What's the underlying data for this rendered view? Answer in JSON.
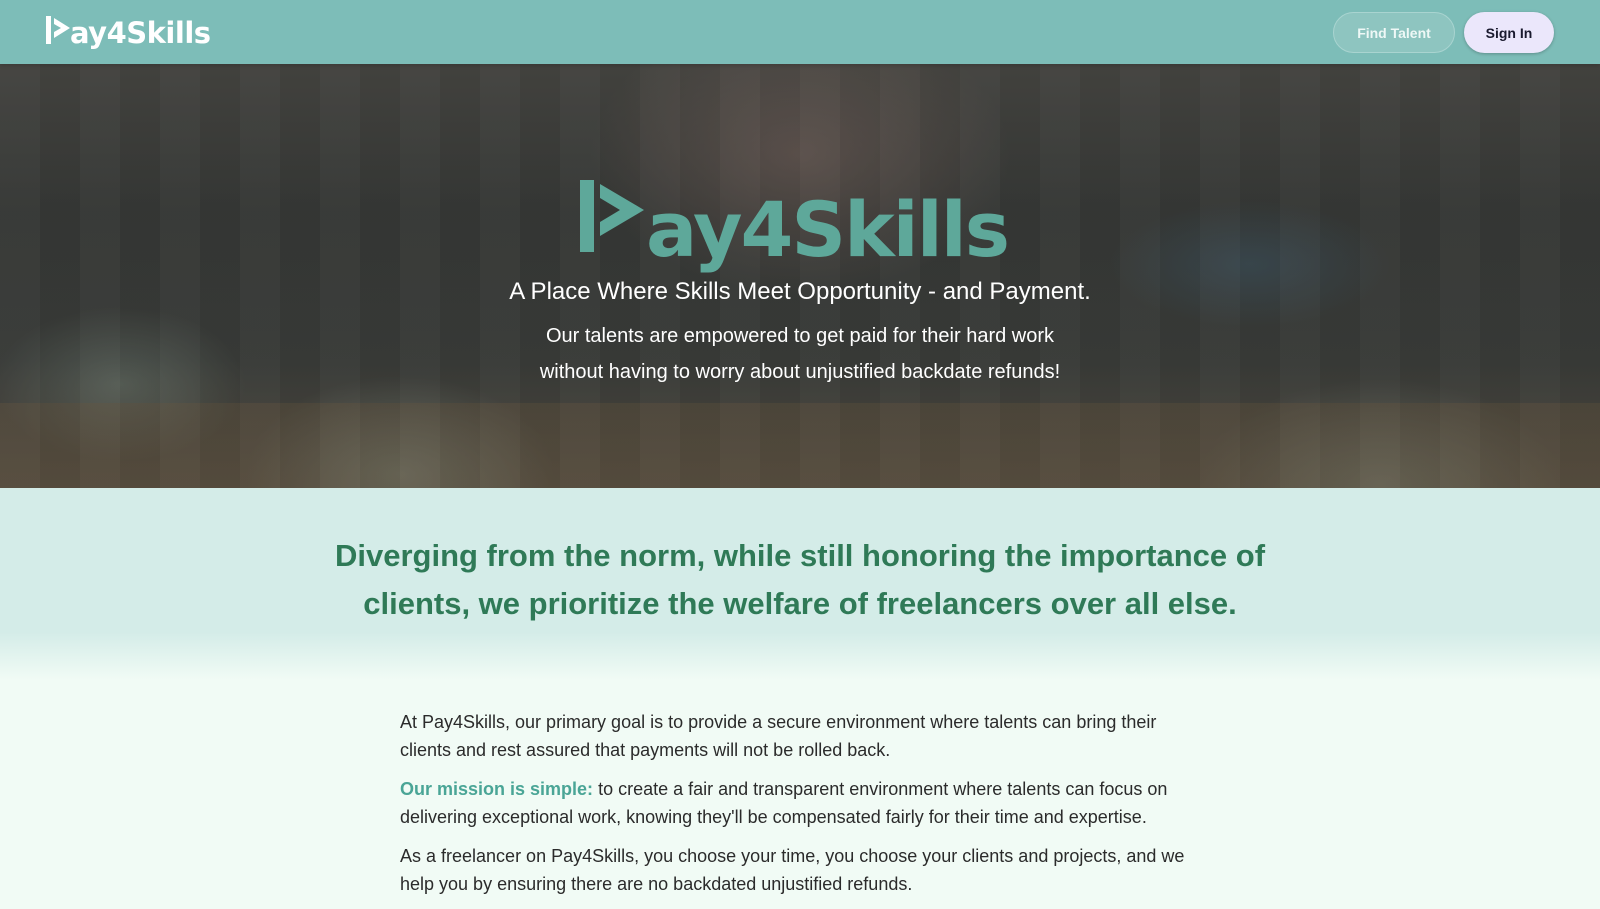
{
  "header": {
    "logo_text": "ay4Skills",
    "find_talent_label": "Find Talent",
    "sign_in_label": "Sign In"
  },
  "hero": {
    "logo_text": "ay4Skills",
    "tagline": "A Place Where Skills Meet Opportunity - and Payment.",
    "sub_line_1": "Our talents are empowered to get paid for their hard work",
    "sub_line_2": "without having to worry about unjustified backdate refunds!"
  },
  "statement": {
    "heading": "Diverging from the norm, while still honoring the importance of clients, we prioritize the welfare of freelancers over all else."
  },
  "content": {
    "paragraph_1": "At Pay4Skills, our primary goal is to provide a secure environment where talents can bring their clients and rest assured that payments will not be rolled back.",
    "mission_label": "Our mission is simple:",
    "mission_text": " to create a fair and transparent environment where talents can focus on delivering exceptional work, knowing they'll be compensated fairly for their time and expertise.",
    "paragraph_3": "As a freelancer on Pay4Skills, you choose your time, you choose your clients and projects, and we help you by ensuring there are no backdated unjustified refunds."
  },
  "colors": {
    "header_bg": "#7dbdb8",
    "brand_green": "#5ea89a",
    "heading_green": "#2f7a57",
    "accent_teal": "#4aa596",
    "statement_bg": "#d4ece8",
    "page_bg": "#f1fbf5"
  },
  "icons": {
    "logo_mark": "play-arrow-p-mark-icon"
  }
}
